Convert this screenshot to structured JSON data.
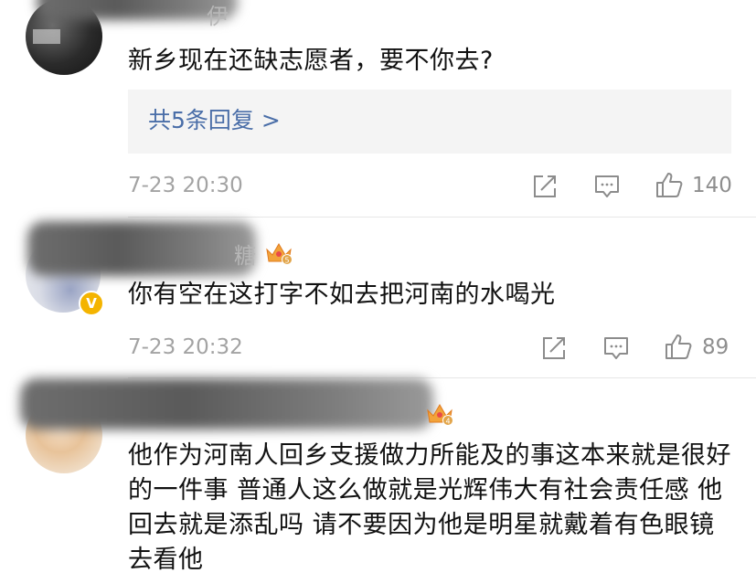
{
  "comments": [
    {
      "name_visible": "伊",
      "text": "新乡现在还缺志愿者，要不你去?",
      "replies_label": "共5条回复 >",
      "time": "7-23 20:30",
      "likes": "140"
    },
    {
      "name_visible": "糖",
      "level_badge": "5",
      "text": "你有空在这打字不如去把河南的水喝光",
      "time": "7-23 20:32",
      "likes": "89"
    },
    {
      "level_badge": "4",
      "text": "他作为河南人回乡支援做力所能及的事这本来就是很好的一件事 普通人这么做就是光辉伟大有社会责任感 他回去就是添乱吗 请不要因为他是明星就戴着有色眼镜去看他"
    }
  ],
  "icons": {
    "share": "share-icon",
    "comment": "comment-icon",
    "like": "thumbs-up-icon",
    "crown": "crown-icon",
    "verified": "verified-v-icon"
  },
  "colors": {
    "reply_link": "#4a6ea8",
    "meta_text": "#a3a3a3",
    "badge_gold": "#f4b400"
  }
}
